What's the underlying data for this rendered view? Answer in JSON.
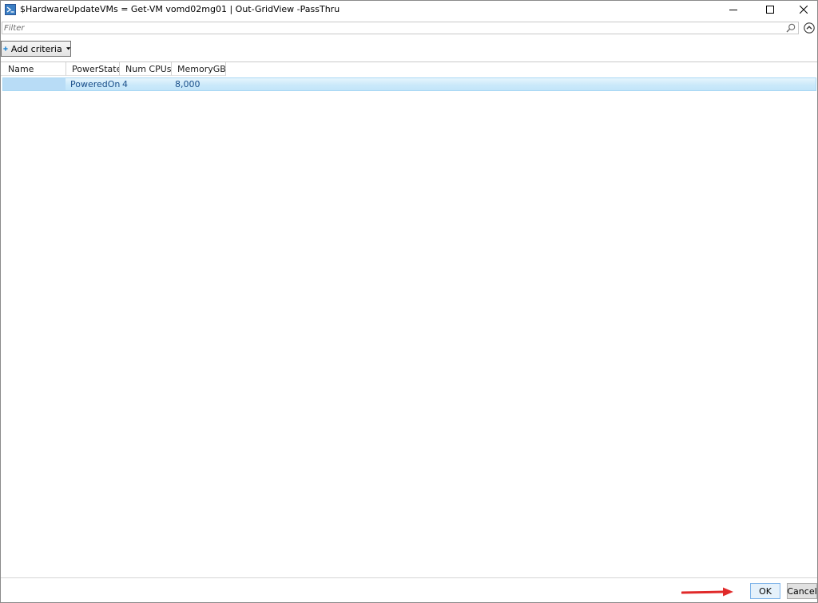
{
  "window": {
    "title": "$HardwareUpdateVMs = Get-VM vomd02mg01 | Out-GridView -PassThru",
    "icon": "powershell-icon",
    "controls": [
      "minimize-icon",
      "maximize-icon",
      "close-icon"
    ]
  },
  "filter": {
    "placeholder": "Filter",
    "value": "",
    "icon": "search-icon",
    "collapse_icon": "chevron-up-circle-icon"
  },
  "toolbar": {
    "add_criteria_label": "Add criteria",
    "add_criteria_icon": "plus-icon",
    "add_criteria_arrow": "dropdown-arrow-icon"
  },
  "grid": {
    "columns": [
      "Name",
      "PowerState",
      "Num CPUs",
      "MemoryGB"
    ],
    "rows": [
      {
        "name": "",
        "power_state": "PoweredOn",
        "num_cpus": "4",
        "memory_gb": "8,000",
        "selected": true
      }
    ]
  },
  "buttons": {
    "ok": "OK",
    "cancel": "Cancel"
  },
  "colors": {
    "selection": "#cbe9fa",
    "selection_border": "#a9d8f4",
    "annotation_arrow": "#e02a2a",
    "accent": "#0078d7"
  }
}
